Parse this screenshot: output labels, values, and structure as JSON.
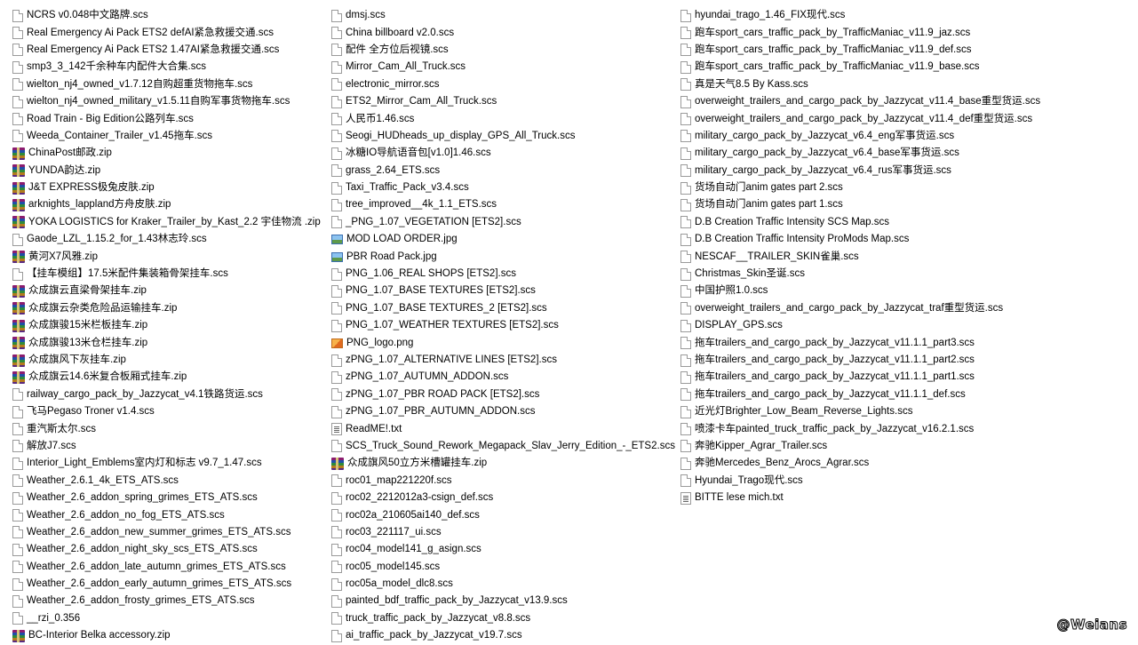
{
  "columns": [
    [
      {
        "name": "NCRS v0.048中文路牌.scs",
        "icon": "file-icon"
      },
      {
        "name": "Real Emergency Ai Pack ETS2 defAI紧急救援交通.scs",
        "icon": "file-icon"
      },
      {
        "name": "Real Emergency Ai Pack ETS2 1.47AI紧急救援交通.scs",
        "icon": "file-icon"
      },
      {
        "name": "smp3_3_142千余种车内配件大合集.scs",
        "icon": "file-icon"
      },
      {
        "name": "wielton_nj4_owned_v1.7.12自购超重货物拖车.scs",
        "icon": "file-icon"
      },
      {
        "name": "wielton_nj4_owned_military_v1.5.11自购军事货物拖车.scs",
        "icon": "file-icon"
      },
      {
        "name": "Road Train - Big Edition公路列车.scs",
        "icon": "file-icon"
      },
      {
        "name": "Weeda_Container_Trailer_v1.45拖车.scs",
        "icon": "file-icon"
      },
      {
        "name": "ChinaPost邮政.zip",
        "icon": "zip-icon"
      },
      {
        "name": "YUNDA韵达.zip",
        "icon": "zip-icon"
      },
      {
        "name": "J&T EXPRESS极兔皮肤.zip",
        "icon": "zip-icon"
      },
      {
        "name": "arknights_lappland方舟皮肤.zip",
        "icon": "zip-icon"
      },
      {
        "name": "YOKA LOGISTICS for Kraker_Trailer_by_Kast_2.2 宇佳物流 .zip",
        "icon": "zip-icon"
      },
      {
        "name": "Gaode_LZL_1.15.2_for_1.43林志玲.scs",
        "icon": "file-icon"
      },
      {
        "name": "黄河X7风雅.zip",
        "icon": "zip-icon"
      },
      {
        "name": "【挂车模组】17.5米配件集装箱骨架挂车.scs",
        "icon": "file-icon"
      },
      {
        "name": "众成旗云直梁骨架挂车.zip",
        "icon": "zip-icon"
      },
      {
        "name": "众成旗云杂类危险品运输挂车.zip",
        "icon": "zip-icon"
      },
      {
        "name": "众成旗骏15米栏板挂车.zip",
        "icon": "zip-icon"
      },
      {
        "name": "众成旗骏13米仓栏挂车.zip",
        "icon": "zip-icon"
      },
      {
        "name": "众成旗风下灰挂车.zip",
        "icon": "zip-icon"
      },
      {
        "name": "众成旗云14.6米复合板厢式挂车.zip",
        "icon": "zip-icon"
      },
      {
        "name": "railway_cargo_pack_by_Jazzycat_v4.1铁路货运.scs",
        "icon": "file-icon"
      },
      {
        "name": "飞马Pegaso Troner v1.4.scs",
        "icon": "file-icon"
      },
      {
        "name": "重汽斯太尔.scs",
        "icon": "file-icon"
      },
      {
        "name": "解放J7.scs",
        "icon": "file-icon"
      },
      {
        "name": "Interior_Light_Emblems室内灯和标志 v9.7_1.47.scs",
        "icon": "file-icon"
      },
      {
        "name": "Weather_2.6.1_4k_ETS_ATS.scs",
        "icon": "file-icon"
      },
      {
        "name": "Weather_2.6_addon_spring_grimes_ETS_ATS.scs",
        "icon": "file-icon"
      },
      {
        "name": "Weather_2.6_addon_no_fog_ETS_ATS.scs",
        "icon": "file-icon"
      },
      {
        "name": "Weather_2.6_addon_new_summer_grimes_ETS_ATS.scs",
        "icon": "file-icon"
      },
      {
        "name": "Weather_2.6_addon_night_sky_scs_ETS_ATS.scs",
        "icon": "file-icon"
      },
      {
        "name": "Weather_2.6_addon_late_autumn_grimes_ETS_ATS.scs",
        "icon": "file-icon"
      },
      {
        "name": "Weather_2.6_addon_early_autumn_grimes_ETS_ATS.scs",
        "icon": "file-icon"
      },
      {
        "name": "Weather_2.6_addon_frosty_grimes_ETS_ATS.scs",
        "icon": "file-icon"
      },
      {
        "name": "__rzi_0.356",
        "icon": "file-icon"
      },
      {
        "name": "BC-Interior Belka accessory.zip",
        "icon": "zip-icon"
      }
    ],
    [
      {
        "name": "dmsj.scs",
        "icon": "file-icon"
      },
      {
        "name": "China billboard v2.0.scs",
        "icon": "file-icon"
      },
      {
        "name": "配件 全方位后视镜.scs",
        "icon": "file-icon"
      },
      {
        "name": "Mirror_Cam_All_Truck.scs",
        "icon": "file-icon"
      },
      {
        "name": "electronic_mirror.scs",
        "icon": "file-icon"
      },
      {
        "name": "ETS2_Mirror_Cam_All_Truck.scs",
        "icon": "file-icon"
      },
      {
        "name": "人民币1.46.scs",
        "icon": "file-icon"
      },
      {
        "name": "Seogi_HUDheads_up_display_GPS_All_Truck.scs",
        "icon": "file-icon"
      },
      {
        "name": "冰糖IO导航语音包[v1.0]1.46.scs",
        "icon": "file-icon"
      },
      {
        "name": "grass_2.64_ETS.scs",
        "icon": "file-icon"
      },
      {
        "name": "Taxi_Traffic_Pack_v3.4.scs",
        "icon": "file-icon"
      },
      {
        "name": "tree_improved__4k_1.1_ETS.scs",
        "icon": "file-icon"
      },
      {
        "name": "_PNG_1.07_VEGETATION [ETS2].scs",
        "icon": "file-icon"
      },
      {
        "name": "MOD LOAD ORDER.jpg",
        "icon": "image-icon"
      },
      {
        "name": "PBR Road Pack.jpg",
        "icon": "image-icon"
      },
      {
        "name": "PNG_1.06_REAL SHOPS [ETS2].scs",
        "icon": "file-icon"
      },
      {
        "name": "PNG_1.07_BASE TEXTURES [ETS2].scs",
        "icon": "file-icon"
      },
      {
        "name": "PNG_1.07_BASE TEXTURES_2 [ETS2].scs",
        "icon": "file-icon"
      },
      {
        "name": "PNG_1.07_WEATHER TEXTURES [ETS2].scs",
        "icon": "file-icon"
      },
      {
        "name": "PNG_logo.png",
        "icon": "png-icon"
      },
      {
        "name": "zPNG_1.07_ALTERNATIVE LINES [ETS2].scs",
        "icon": "file-icon"
      },
      {
        "name": "zPNG_1.07_AUTUMN_ADDON.scs",
        "icon": "file-icon"
      },
      {
        "name": "zPNG_1.07_PBR ROAD PACK [ETS2].scs",
        "icon": "file-icon"
      },
      {
        "name": "zPNG_1.07_PBR_AUTUMN_ADDON.scs",
        "icon": "file-icon"
      },
      {
        "name": "ReadME!.txt",
        "icon": "text-file-icon"
      },
      {
        "name": "SCS_Truck_Sound_Rework_Megapack_Slav_Jerry_Edition_-_ETS2.scs",
        "icon": "file-icon"
      },
      {
        "name": "众成旗风50立方米槽罐挂车.zip",
        "icon": "zip-icon"
      },
      {
        "name": "roc01_map221220f.scs",
        "icon": "file-icon"
      },
      {
        "name": "roc02_2212012a3-csign_def.scs",
        "icon": "file-icon"
      },
      {
        "name": "roc02a_210605ai140_def.scs",
        "icon": "file-icon"
      },
      {
        "name": "roc03_221117_ui.scs",
        "icon": "file-icon"
      },
      {
        "name": "roc04_model141_g_asign.scs",
        "icon": "file-icon"
      },
      {
        "name": "roc05_model145.scs",
        "icon": "file-icon"
      },
      {
        "name": "roc05a_model_dlc8.scs",
        "icon": "file-icon"
      },
      {
        "name": "painted_bdf_traffic_pack_by_Jazzycat_v13.9.scs",
        "icon": "file-icon"
      },
      {
        "name": "truck_traffic_pack_by_Jazzycat_v8.8.scs",
        "icon": "file-icon"
      },
      {
        "name": "ai_traffic_pack_by_Jazzycat_v19.7.scs",
        "icon": "file-icon"
      }
    ],
    [
      {
        "name": "hyundai_trago_1.46_FIX现代.scs",
        "icon": "file-icon"
      },
      {
        "name": "跑车sport_cars_traffic_pack_by_TrafficManiac_v11.9_jaz.scs",
        "icon": "file-icon"
      },
      {
        "name": "跑车sport_cars_traffic_pack_by_TrafficManiac_v11.9_def.scs",
        "icon": "file-icon"
      },
      {
        "name": "跑车sport_cars_traffic_pack_by_TrafficManiac_v11.9_base.scs",
        "icon": "file-icon"
      },
      {
        "name": "真是天气8.5 By Kass.scs",
        "icon": "file-icon"
      },
      {
        "name": "overweight_trailers_and_cargo_pack_by_Jazzycat_v11.4_base重型货运.scs",
        "icon": "file-icon"
      },
      {
        "name": "overweight_trailers_and_cargo_pack_by_Jazzycat_v11.4_def重型货运.scs",
        "icon": "file-icon"
      },
      {
        "name": "military_cargo_pack_by_Jazzycat_v6.4_eng军事货运.scs",
        "icon": "file-icon"
      },
      {
        "name": "military_cargo_pack_by_Jazzycat_v6.4_base军事货运.scs",
        "icon": "file-icon"
      },
      {
        "name": "military_cargo_pack_by_Jazzycat_v6.4_rus军事货运.scs",
        "icon": "file-icon"
      },
      {
        "name": "货场自动门anim gates part 2.scs",
        "icon": "file-icon"
      },
      {
        "name": "货场自动门anim gates part 1.scs",
        "icon": "file-icon"
      },
      {
        "name": "D.B Creation Traffic Intensity SCS Map.scs",
        "icon": "file-icon"
      },
      {
        "name": "D.B Creation Traffic Intensity ProMods Map.scs",
        "icon": "file-icon"
      },
      {
        "name": "NESCAF__TRAILER_SKIN雀巢.scs",
        "icon": "file-icon"
      },
      {
        "name": "Christmas_Skin圣诞.scs",
        "icon": "file-icon"
      },
      {
        "name": "中国护照1.0.scs",
        "icon": "file-icon"
      },
      {
        "name": "overweight_trailers_and_cargo_pack_by_Jazzycat_traf重型货运.scs",
        "icon": "file-icon"
      },
      {
        "name": "DISPLAY_GPS.scs",
        "icon": "file-icon"
      },
      {
        "name": "拖车trailers_and_cargo_pack_by_Jazzycat_v11.1.1_part3.scs",
        "icon": "file-icon"
      },
      {
        "name": "拖车trailers_and_cargo_pack_by_Jazzycat_v11.1.1_part2.scs",
        "icon": "file-icon"
      },
      {
        "name": "拖车trailers_and_cargo_pack_by_Jazzycat_v11.1.1_part1.scs",
        "icon": "file-icon"
      },
      {
        "name": "拖车trailers_and_cargo_pack_by_Jazzycat_v11.1.1_def.scs",
        "icon": "file-icon"
      },
      {
        "name": "近光灯Brighter_Low_Beam_Reverse_Lights.scs",
        "icon": "file-icon"
      },
      {
        "name": "喷漆卡车painted_truck_traffic_pack_by_Jazzycat_v16.2.1.scs",
        "icon": "file-icon"
      },
      {
        "name": "奔驰Kipper_Agrar_Trailer.scs",
        "icon": "file-icon"
      },
      {
        "name": "奔驰Mercedes_Benz_Arocs_Agrar.scs",
        "icon": "file-icon"
      },
      {
        "name": "Hyundai_Trago现代.scs",
        "icon": "file-icon"
      },
      {
        "name": "BITTE lese mich.txt",
        "icon": "text-file-icon"
      }
    ]
  ],
  "watermark": "@Weians"
}
